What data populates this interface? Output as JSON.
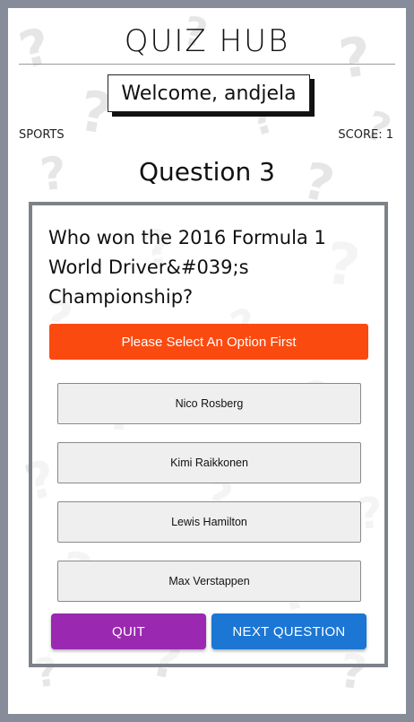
{
  "app": {
    "title": "QUIZ HUB"
  },
  "user": {
    "welcome": "Welcome, andjela"
  },
  "quiz": {
    "category": "SPORTS",
    "score": "SCORE: 1",
    "question_number": "Question 3",
    "question_text": "Who won the 2016 Formula 1 World Driver&#039;s Championship?",
    "alert": "Please Select An Option First",
    "options": [
      {
        "label": "Nico Rosberg"
      },
      {
        "label": "Kimi Raikkonen"
      },
      {
        "label": "Lewis Hamilton"
      },
      {
        "label": "Max Verstappen"
      }
    ]
  },
  "actions": {
    "quit": "QUIT",
    "next": "NEXT QUESTION"
  },
  "colors": {
    "frame": "#868c99",
    "alert": "#fb4a10",
    "quit": "#9a28b0",
    "next": "#1b76d4"
  },
  "background": {
    "pattern_icon": "question-mark-icon"
  }
}
